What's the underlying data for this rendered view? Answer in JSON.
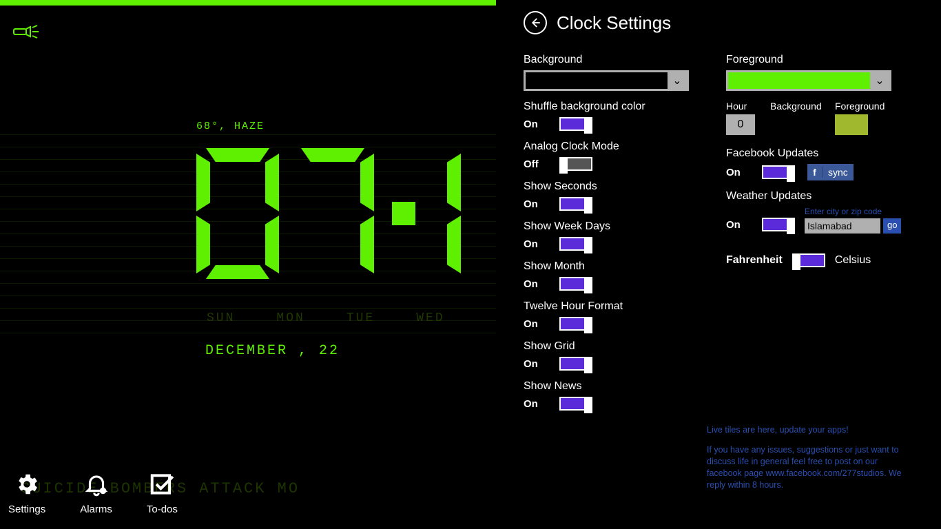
{
  "header": {
    "title": "Clock Settings"
  },
  "clock": {
    "weather": "68°, HAZE",
    "date": "DECEMBER , 22",
    "weekdays": [
      "SUN",
      "MON",
      "TUE",
      "WED"
    ],
    "ticker": "SUICIDE BOMBERS ATTACK MO"
  },
  "bottom": {
    "settings": "Settings",
    "alarms": "Alarms",
    "todos": "To-dos"
  },
  "colors": {
    "accent": "#5fef00",
    "toggle_on": "#5b2bd9"
  },
  "left_toggles": [
    {
      "label": "Shuffle background color",
      "state": "On"
    },
    {
      "label": "Analog Clock Mode",
      "state": "Off"
    },
    {
      "label": "Show Seconds",
      "state": "On"
    },
    {
      "label": "Show Week Days",
      "state": "On"
    },
    {
      "label": "Show Month",
      "state": "On"
    },
    {
      "label": "Twelve Hour Format",
      "state": "On"
    },
    {
      "label": "Show Grid",
      "state": "On"
    },
    {
      "label": "Show News",
      "state": "On"
    }
  ],
  "pickers": {
    "background_label": "Background",
    "foreground_label": "Foreground",
    "background_value": "#000000",
    "foreground_value": "#5fef00"
  },
  "mini": {
    "hour_label": "Hour",
    "bg_label": "Background",
    "fg_label": "Foreground",
    "hour_value": "0",
    "bg_value": "#000000",
    "fg_value": "#a0b82e"
  },
  "facebook": {
    "label": "Facebook Updates",
    "state": "On",
    "sync": "sync",
    "f": "f"
  },
  "weather_updates": {
    "label": "Weather Updates",
    "state": "On",
    "hint": "Enter city or zip code",
    "city": "Islamabad",
    "go": "go"
  },
  "units": {
    "fahrenheit": "Fahrenheit",
    "celsius": "Celsius"
  },
  "promo": {
    "line1": "Live tiles are here, update your apps!",
    "line2": "If you have any issues, suggestions or just want to discuss life in general feel free to post on our facebook page www.facebook.com/277studios. We reply within 8 hours."
  }
}
